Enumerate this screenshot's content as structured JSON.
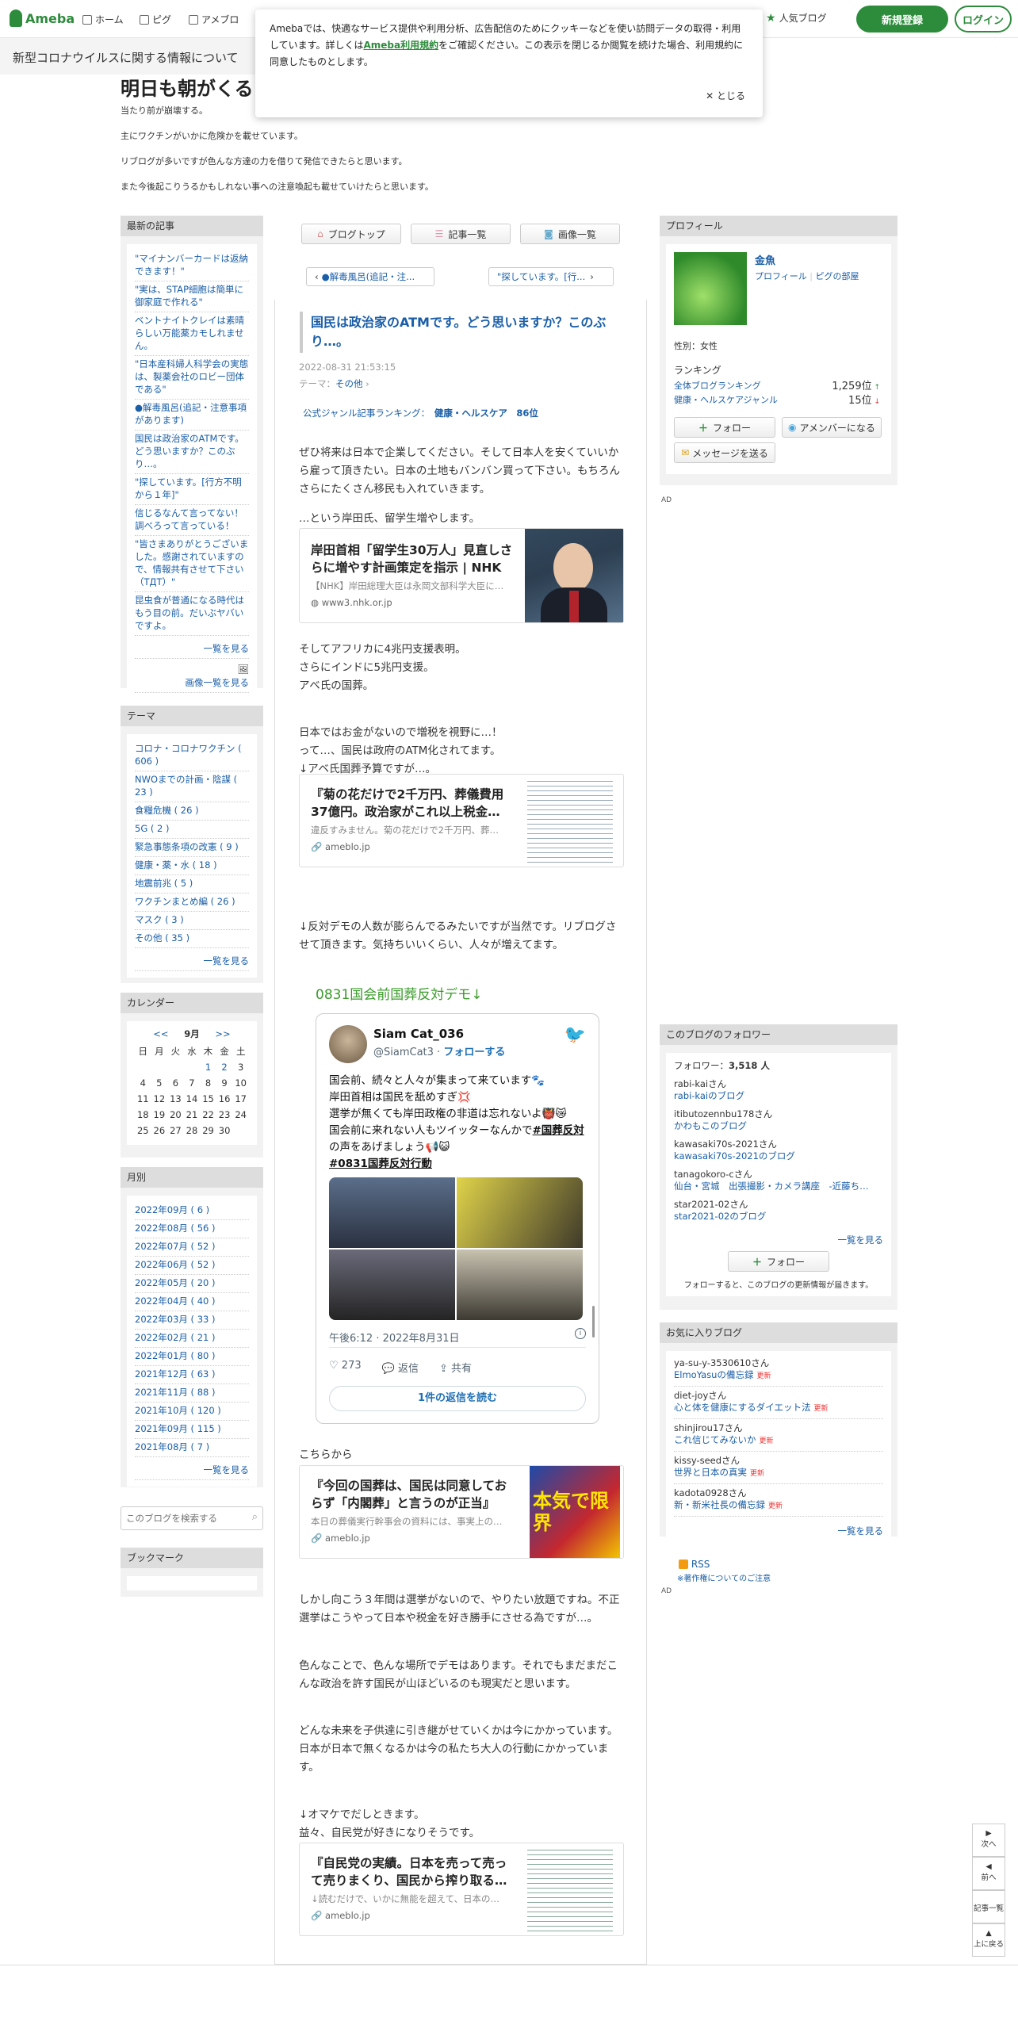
{
  "header": {
    "brand": "Ameba",
    "nav": [
      "ホーム",
      "ピグ",
      "アメブロ"
    ],
    "popular": "人気ブログ",
    "signup": "新規登録",
    "login": "ログイン",
    "covid": "新型コロナウイルスに関する情報について"
  },
  "cookie": {
    "text1": "Amebaでは、快適なサービス提供や利用分析、広告配信のためにクッキーなどを使い訪問データの取得・利用しています。詳しくは",
    "link": "Ameba利用規約",
    "text2": "をご確認ください。この表示を閉じるか閲覧を続けた場合、利用規約に同意したものとします。",
    "close": "とじる"
  },
  "blog": {
    "title": "明日も朝がくる",
    "desc": [
      "当たり前が崩壊する。",
      "主にワクチンがいかに危険かを載せています。",
      "リブログが多いですが色んな方達の力を借りて発信できたらと思います。",
      "また今後起こりうるかもしれない事への注意喚起も載せていけたらと思います。"
    ]
  },
  "recent": {
    "heading": "最新の記事",
    "items": [
      "\"マイナンバーカードは返納できます！\"",
      "\"実は、STAP細胞は簡単に御家庭で作れる\"",
      "ベントナイトクレイは素晴らしい万能薬カモしれません。",
      "\"日本産科婦人科学会の実態は、製薬会社のロビー団体である\"",
      "●解毒風呂(追記・注意事項があります)",
      "国民は政治家のATMです。どう思いますか？このぶり…。",
      "\"探しています。[行方不明から１年]\"",
      "信じるなんて言ってない！調べろって言っている！",
      "\"皆さまありがとうございました。感謝されていますので、情報共有させて下さい（TДT）\"",
      "昆虫食が普通になる時代はもう目の前。だいぶヤバいですよ。"
    ],
    "more": "一覧を見る",
    "more_images": "画像一覧を見る"
  },
  "themes": {
    "heading": "テーマ",
    "items": [
      "コロナ・コロナワクチン ( 606 )",
      "NWOまでの計画・陰謀 ( 23 )",
      "食糧危機 ( 26 )",
      "5G ( 2 )",
      "緊急事態条項の改憲 ( 9 )",
      "健康・薬・水 ( 18 )",
      "地震前兆 ( 5 )",
      "ワクチンまとめ編 ( 26 )",
      "マスク ( 3 )",
      "その他 ( 35 )"
    ],
    "more": "一覧を見る"
  },
  "calendar": {
    "heading": "カレンダー",
    "prev": "<<",
    "month": "9月",
    "next": ">>",
    "days": [
      "日",
      "月",
      "火",
      "水",
      "木",
      "金",
      "土"
    ],
    "weeks": [
      [
        "",
        "",
        "",
        "",
        "1",
        "2",
        "3"
      ],
      [
        "4",
        "5",
        "6",
        "7",
        "8",
        "9",
        "10"
      ],
      [
        "11",
        "12",
        "13",
        "14",
        "15",
        "16",
        "17"
      ],
      [
        "18",
        "19",
        "20",
        "21",
        "22",
        "23",
        "24"
      ],
      [
        "25",
        "26",
        "27",
        "28",
        "29",
        "30",
        ""
      ]
    ]
  },
  "months": {
    "heading": "月別",
    "items": [
      "2022年09月 ( 6 )",
      "2022年08月 ( 56 )",
      "2022年07月 ( 52 )",
      "2022年06月 ( 52 )",
      "2022年05月 ( 20 )",
      "2022年04月 ( 40 )",
      "2022年03月 ( 33 )",
      "2022年02月 ( 21 )",
      "2022年01月 ( 80 )",
      "2021年12月 ( 63 )",
      "2021年11月 ( 88 )",
      "2021年10月 ( 120 )",
      "2021年09月 ( 115 )",
      "2021年08月 ( 7 )"
    ],
    "more": "一覧を見る"
  },
  "search": {
    "placeholder": "このブログを検索する"
  },
  "bookmark": {
    "heading": "ブックマーク"
  },
  "toolbar": {
    "top": "ブログトップ",
    "list": "記事一覧",
    "images": "画像一覧"
  },
  "pager": {
    "prev": "●解毒風呂(追記・注...",
    "next": "\"探しています。[行..."
  },
  "entry": {
    "title": "国民は政治家のATMです。どう思いますか？このぶり…。",
    "date": "2022-08-31 21:53:15",
    "theme_label": "テーマ：",
    "theme": "その他",
    "ranking_label": "公式ジャンル記事ランキング：",
    "ranking_genre": "健康・ヘルスケア",
    "ranking_pos": "86位",
    "p1": "ぜひ将来は日本で企業してください。そして日本人を安くていいから雇って頂きたい。日本の土地もバンバン買って下さい。もちろんさらにたくさん移民も入れていきます。",
    "p2": "…という岸田氏、留学生増やします。",
    "card1": {
      "title": "岸田首相「留学生30万人」見直しさらに増やす計画策定を指示 | NHK",
      "desc": "【NHK】岸田総理大臣は永岡文部科学大臣に…",
      "url": "www3.nhk.or.jp"
    },
    "p3": [
      "そしてアフリカに4兆円支援表明。",
      "さらにインドに5兆円支援。",
      "アベ氏の国葬。"
    ],
    "p4": [
      "日本ではお金がないので増税を視野に…！",
      "って…、国民は政府のATM化されてます。",
      "↓アベ氏国葬予算ですが…。"
    ],
    "card2": {
      "title": "『菊の花だけで2千万円、葬儀費用37億円。政治家がこれ以上税金…",
      "desc": "違反すみません。菊の花だけで2千万円、葬…",
      "url": "ameblo.jp"
    },
    "p5": "↓反対デモの人数が膨らんでるみたいですが当然です。リブログさせて頂きます。気持ちいいくらい、人々が増えてます。",
    "demo": "0831国会前国葬反対デモ↓",
    "tweet": {
      "name": "Siam Cat_036",
      "handle": "@SiamCat3",
      "follow": "フォローする",
      "lines": [
        "国会前、続々と人々が集まって来ています🐾",
        "岸田首相は国民を舐めすぎ💢",
        "選挙が無くても岸田政権の非道は忘れないよ👹😿",
        "国会前に来れない人もツイッターなんかで"
      ],
      "hashtag1": "#国葬反対",
      "after": "の声をあげましょう📢😺",
      "hashtag2": "#0831国葬反対行動",
      "time": "午後6:12 · 2022年8月31日",
      "likes": "273",
      "reply": "返信",
      "share": "共有",
      "read_replies": "1件の返信を読む"
    },
    "p6": "こちらから",
    "card3": {
      "title": "『今回の国葬は、国民は同意しておらず「内閣葬」と言うのが正当』",
      "desc": "本日の葬儀実行幹事会の資料には、事実上の…",
      "url": "ameblo.jp",
      "thumb_text": "本気で限界"
    },
    "p7": "しかし向こう３年間は選挙がないので、やりたい放題ですね。不正選挙はこうやって日本や税金を好き勝手にさせる為ですが…。",
    "p8": "色んなことで、色んな場所でデモはあります。それでもまだまだこんな政治を許す国民が山ほどいるのも現実だと思います。",
    "p9": "どんな未来を子供達に引き継がせていくかは今にかかっています。日本が日本で無くなるかは今の私たち大人の行動にかかっています。",
    "p10": [
      "↓オマケでだしときます。",
      "益々、自民党が好きになりそうです。"
    ],
    "card4": {
      "title": "『自民党の実績。日本を売って売って売りまくり、国民から搾り取る…",
      "desc": "↓読むだけで、いかに無能を超えて、日本の…",
      "url": "ameblo.jp"
    }
  },
  "profile": {
    "heading": "プロフィール",
    "name": "金魚",
    "profile_link": "プロフィール",
    "room_link": "ピグの部屋",
    "gender": "性別：女性",
    "ranking_label": "ランキング",
    "rank1_label": "全体ブログランキング",
    "rank1": "1,259位",
    "rank2_label": "健康・ヘルスケアジャンル",
    "rank2": "15位",
    "follow": "フォロー",
    "member": "アメンバーになる",
    "message": "メッセージを送る",
    "ad": "AD"
  },
  "followers": {
    "heading": "このブログのフォロワー",
    "count_label": "フォロワー：",
    "count": "3,518 人",
    "items": [
      {
        "n": "rabi-kaiさん",
        "b": "rabi-kaiのブログ"
      },
      {
        "n": "itibutozennbu178さん",
        "b": "かわもこのブログ"
      },
      {
        "n": "kawasaki70s-2021さん",
        "b": "kawasaki70s-2021のブログ"
      },
      {
        "n": "tanagokoro-cさん",
        "b": "仙台・宮城　出張撮影・カメラ講座　-近藤ち…"
      },
      {
        "n": "star2021-02さん",
        "b": "star2021-02のブログ"
      }
    ],
    "more": "一覧を見る",
    "follow": "フォロー",
    "note": "フォローすると、このブログの更新情報が届きます。"
  },
  "favorites": {
    "heading": "お気に入りブログ",
    "items": [
      {
        "n": "ya-su-y-3530610さん",
        "b": "ElmoYasuの備忘録",
        "u": "更新"
      },
      {
        "n": "diet-joyさん",
        "b": "心と体を健康にするダイエット法",
        "u": "更新"
      },
      {
        "n": "shinjirou17さん",
        "b": "これ信じてみないか",
        "u": "更新"
      },
      {
        "n": "kissy-seedさん",
        "b": "世界と日本の真実",
        "u": "更新"
      },
      {
        "n": "kadota0928さん",
        "b": "新・新米社長の備忘録",
        "u": "更新"
      }
    ],
    "more": "一覧を見る"
  },
  "rss": {
    "label": "RSS",
    "note": "※著作権についてのご注意",
    "ad": "AD"
  },
  "rnav": {
    "next": "次へ",
    "prev": "前へ",
    "list": "記事一覧",
    "top": "上に戻る"
  }
}
